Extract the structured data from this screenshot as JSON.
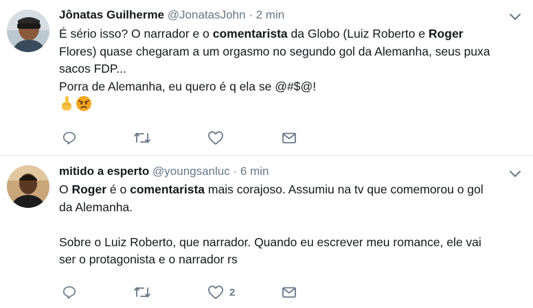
{
  "tweets": [
    {
      "name": "Jônatas Guilherme",
      "handle": "@JonatasJohn",
      "separator": "·",
      "time": "2 min",
      "lines": [
        [
          {
            "t": "É sério isso? O narrador e o "
          },
          {
            "t": "comentarista",
            "b": true
          },
          {
            "t": " da Globo (Luiz Roberto e "
          },
          {
            "t": "Roger",
            "b": true
          }
        ],
        [
          {
            "t": "Flores) quase chegaram a um orgasmo no segundo gol da Alemanha, seus puxa"
          }
        ],
        [
          {
            "t": "sacos FDP..."
          }
        ],
        [
          {
            "t": "Porra de Alemanha, eu quero é q ela se @#$@!"
          }
        ]
      ],
      "emoji": [
        "middle-finger-emoji",
        "angry-face-emoji"
      ],
      "actions": {
        "reply": "",
        "retweet": "",
        "like": "",
        "dm": ""
      }
    },
    {
      "name": "mitido a esperto",
      "handle": "@youngsanluc",
      "separator": "·",
      "time": "6 min",
      "lines": [
        [
          {
            "t": "O "
          },
          {
            "t": "Roger",
            "b": true
          },
          {
            "t": " é o "
          },
          {
            "t": "comentarista",
            "b": true
          },
          {
            "t": " mais corajoso. Assumiu na tv que comemorou o gol"
          }
        ],
        [
          {
            "t": "da Alemanha."
          }
        ],
        [],
        [
          {
            "t": "Sobre o Luiz Roberto, que narrador. Quando eu escrever meu romance, ele vai"
          }
        ],
        [
          {
            "t": "ser o protagonista e o narrador rs"
          }
        ]
      ],
      "actions": {
        "reply": "",
        "retweet": "",
        "like": "2",
        "dm": ""
      }
    }
  ],
  "colors": {
    "text": "#14171a",
    "secondary": "#657786",
    "divider": "#e6ecf0"
  }
}
